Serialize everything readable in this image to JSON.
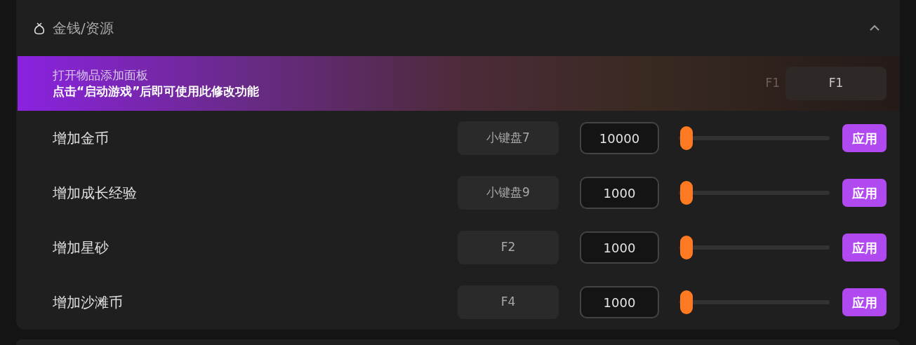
{
  "section": {
    "title": "金钱/资源",
    "expanded": true
  },
  "banner": {
    "title": "打开物品添加面板",
    "note": "点击“启动游戏”后即可使用此修改功能",
    "ghost_key": "F1",
    "hotkey": "F1"
  },
  "rows": [
    {
      "label": "增加金币",
      "hotkey": "小键盘7",
      "value": "10000",
      "level": 0.01,
      "button": "应用"
    },
    {
      "label": "增加成长经验",
      "hotkey": "小键盘9",
      "value": "1000",
      "level": 0.01,
      "button": "应用"
    },
    {
      "label": "增加星砂",
      "hotkey": "F2",
      "value": "1000",
      "level": 0.01,
      "button": "应用"
    },
    {
      "label": "增加沙滩币",
      "hotkey": "F4",
      "value": "1000",
      "level": 0.01,
      "button": "应用"
    }
  ]
}
